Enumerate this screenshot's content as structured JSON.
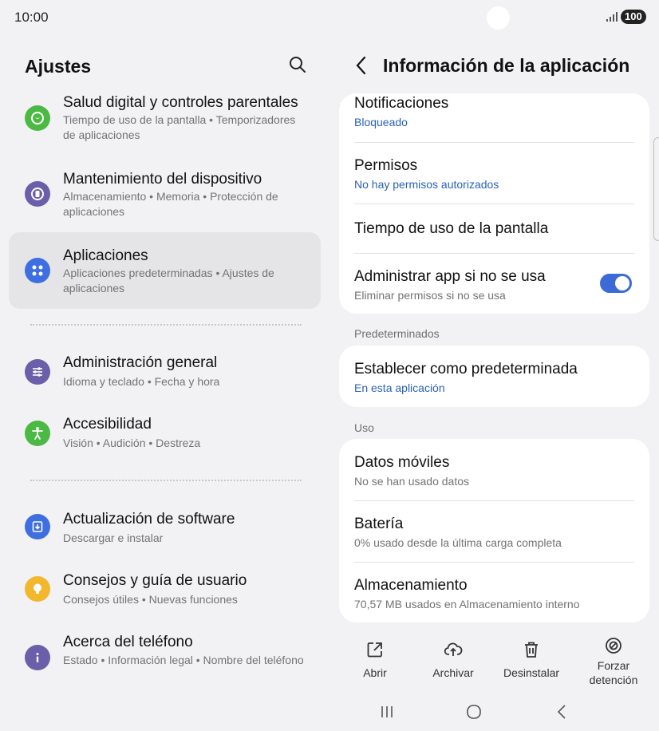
{
  "status": {
    "time": "10:00",
    "battery": "100"
  },
  "settings": {
    "title": "Ajustes",
    "items": [
      {
        "title": "Salud digital y controles parentales",
        "subtitle": "Tiempo de uso de la pantalla  •  Temporizadores de aplicaciones",
        "icon": "digital-wellbeing-icon",
        "color": "#4cb944"
      },
      {
        "title": "Mantenimiento del dispositivo",
        "subtitle": "Almacenamiento  •  Memoria  •  Protección de aplicaciones",
        "icon": "device-care-icon",
        "color": "#6a5fa8"
      },
      {
        "title": "Aplicaciones",
        "subtitle": "Aplicaciones predeterminadas  •  Ajustes de aplicaciones",
        "icon": "apps-icon",
        "color": "#3e6fe0"
      },
      {
        "title": "Administración general",
        "subtitle": "Idioma y teclado  •  Fecha y hora",
        "icon": "sliders-icon",
        "color": "#6a5fa8"
      },
      {
        "title": "Accesibilidad",
        "subtitle": "Visión  •  Audición  •  Destreza",
        "icon": "accessibility-icon",
        "color": "#4cb944"
      },
      {
        "title": "Actualización de software",
        "subtitle": "Descargar e instalar",
        "icon": "software-update-icon",
        "color": "#3e6fe0"
      },
      {
        "title": "Consejos y guía de usuario",
        "subtitle": "Consejos útiles  •  Nuevas funciones",
        "icon": "bulb-icon",
        "color": "#f2b72c"
      },
      {
        "title": "Acerca del teléfono",
        "subtitle": "Estado  •  Información legal  •  Nombre del teléfono",
        "icon": "info-icon",
        "color": "#6a5fa8"
      }
    ]
  },
  "app_info": {
    "title": "Información de la aplicación",
    "notifications": {
      "title": "Notificaciones",
      "value": "Bloqueado"
    },
    "permissions": {
      "title": "Permisos",
      "value": "No hay permisos autorizados"
    },
    "screen_time": {
      "title": "Tiempo de uso de la pantalla"
    },
    "manage_unused": {
      "title": "Administrar app si no se usa",
      "subtitle": "Eliminar permisos si no se usa",
      "enabled": true
    },
    "defaults_label": "Predeterminados",
    "set_default": {
      "title": "Establecer como predeterminada",
      "value": "En esta aplicación"
    },
    "usage_label": "Uso",
    "mobile_data": {
      "title": "Datos móviles",
      "subtitle": "No se han usado datos"
    },
    "battery": {
      "title": "Batería",
      "subtitle": "0% usado desde la última carga completa"
    },
    "storage": {
      "title": "Almacenamiento",
      "subtitle": "70,57 MB usados en Almacenamiento interno"
    },
    "actions": {
      "open": "Abrir",
      "archive": "Archivar",
      "uninstall": "Desinstalar",
      "force_stop_1": "Forzar",
      "force_stop_2": "detención"
    }
  },
  "colors": {
    "accent": "#3c6bd8",
    "link": "#2a62b8",
    "selected_bg": "#e5e5e8"
  }
}
